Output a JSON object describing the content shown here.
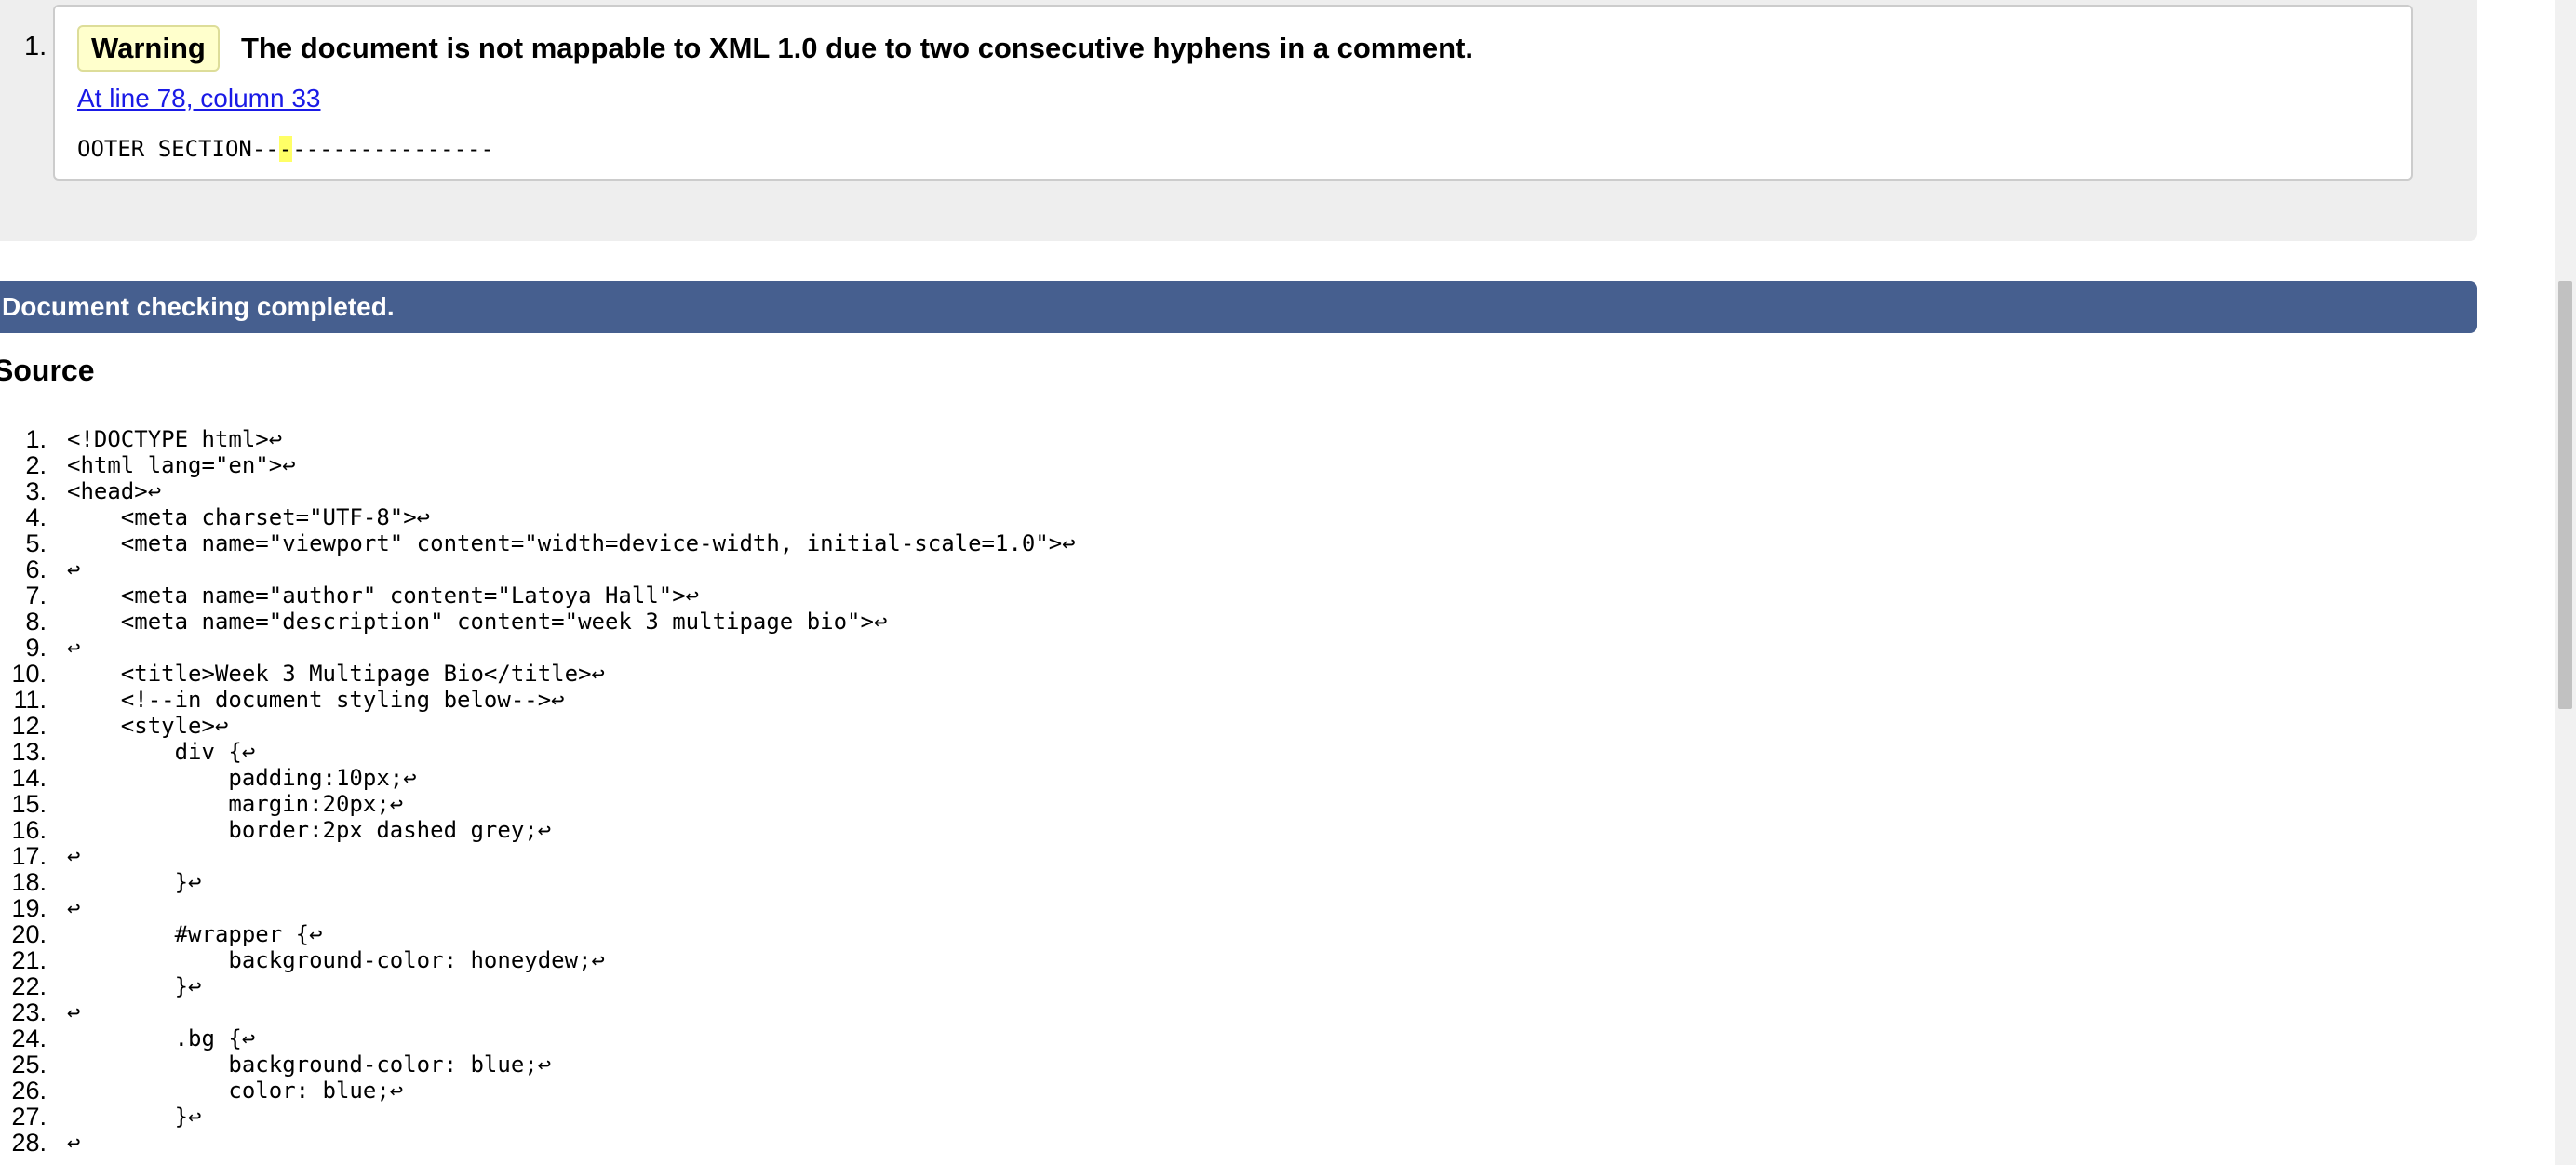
{
  "results": {
    "number": "1.",
    "badge": "Warning",
    "message": "The document is not mappable to XML 1.0 due to two consecutive hyphens in a comment.",
    "location": "At line 78, column 33",
    "extract_before": "OOTER SECTION--",
    "extract_highlight": "-",
    "extract_after": "---------------"
  },
  "status": {
    "text": "Document checking completed."
  },
  "source": {
    "heading": "Source",
    "lines": [
      {
        "num": "1.",
        "code": "<!DOCTYPE html>↩"
      },
      {
        "num": "2.",
        "code": "<html lang=\"en\">↩"
      },
      {
        "num": "3.",
        "code": "<head>↩"
      },
      {
        "num": "4.",
        "code": "    <meta charset=\"UTF-8\">↩"
      },
      {
        "num": "5.",
        "code": "    <meta name=\"viewport\" content=\"width=device-width, initial-scale=1.0\">↩"
      },
      {
        "num": "6.",
        "code": "↩"
      },
      {
        "num": "7.",
        "code": "    <meta name=\"author\" content=\"Latoya Hall\">↩"
      },
      {
        "num": "8.",
        "code": "    <meta name=\"description\" content=\"week 3 multipage bio\">↩"
      },
      {
        "num": "9.",
        "code": "↩"
      },
      {
        "num": "10.",
        "code": "    <title>Week 3 Multipage Bio</title>↩"
      },
      {
        "num": "11.",
        "code": "    <!--in document styling below-->↩"
      },
      {
        "num": "12.",
        "code": "    <style>↩"
      },
      {
        "num": "13.",
        "code": "        div {↩"
      },
      {
        "num": "14.",
        "code": "            padding:10px;↩"
      },
      {
        "num": "15.",
        "code": "            margin:20px;↩"
      },
      {
        "num": "16.",
        "code": "            border:2px dashed grey;↩"
      },
      {
        "num": "17.",
        "code": "↩"
      },
      {
        "num": "18.",
        "code": "        }↩"
      },
      {
        "num": "19.",
        "code": "↩"
      },
      {
        "num": "20.",
        "code": "        #wrapper {↩"
      },
      {
        "num": "21.",
        "code": "            background-color: honeydew;↩"
      },
      {
        "num": "22.",
        "code": "        }↩"
      },
      {
        "num": "23.",
        "code": "↩"
      },
      {
        "num": "24.",
        "code": "        .bg {↩"
      },
      {
        "num": "25.",
        "code": "            background-color: blue;↩"
      },
      {
        "num": "26.",
        "code": "            color: blue;↩"
      },
      {
        "num": "27.",
        "code": "        }↩"
      },
      {
        "num": "28.",
        "code": "↩"
      }
    ]
  },
  "colors": {
    "status_bar": "#465f8f",
    "badge_bg": "#ffffcc",
    "link": "#1a1ae6",
    "highlight": "#ffff66"
  }
}
